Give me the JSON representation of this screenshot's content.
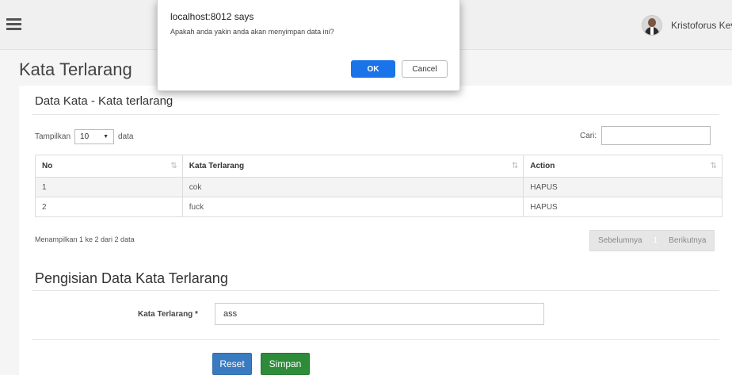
{
  "navbar": {
    "menu_icon": "hamburger-menu-icon",
    "user_name": "Kristoforus Kevin"
  },
  "page_title": "Kata Terlarang",
  "list_section": {
    "title": "Data Kata - Kata terlarang",
    "length_prefix": "Tampilkan",
    "length_value": "10",
    "length_suffix": "data",
    "search_label": "Cari:",
    "search_value": "",
    "columns": [
      "No",
      "Kata Terlarang",
      "Action"
    ],
    "rows": [
      {
        "no": "1",
        "kata": "cok",
        "action": "HAPUS"
      },
      {
        "no": "2",
        "kata": "fuck",
        "action": "HAPUS"
      }
    ],
    "info": "Menampilkan 1 ke 2 dari 2 data",
    "pager": {
      "prev": "Sebelumnya",
      "current": "1",
      "next": "Berikutnya"
    }
  },
  "form": {
    "title": "Pengisian Data Kata Terlarang",
    "label": "Kata Terlarang *",
    "value": "ass",
    "reset_label": "Reset",
    "save_label": "Simpan"
  },
  "dialog": {
    "title": "localhost:8012 says",
    "message": "Apakah anda yakin anda akan menyimpan data ini?",
    "ok_label": "OK",
    "cancel_label": "Cancel"
  },
  "colors": {
    "primary": "#3a7ac0",
    "success": "#2e8b3a",
    "dialog_ok": "#1a73e8"
  }
}
